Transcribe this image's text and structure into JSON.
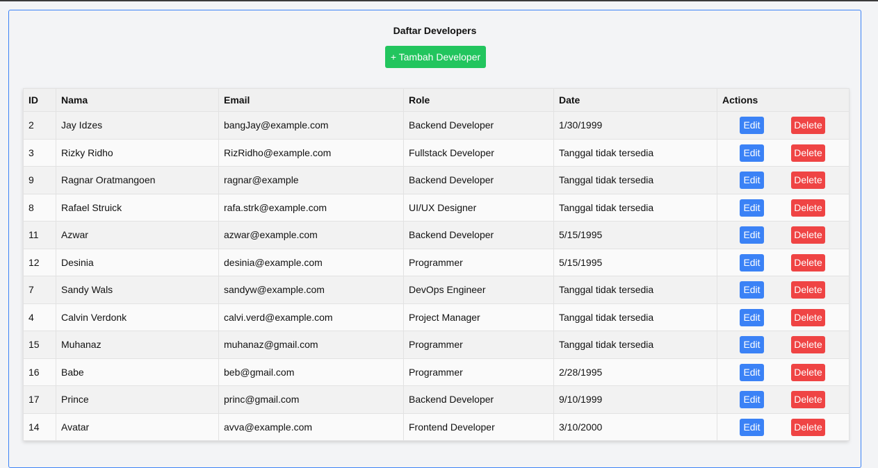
{
  "page": {
    "title": "Daftar Developers",
    "add_button_label": "+ Tambah Developer"
  },
  "colors": {
    "add_button": "#22c55e",
    "edit_button": "#3b82f6",
    "delete_button": "#ef4444",
    "card_border": "#3b82f6"
  },
  "table": {
    "headers": [
      "ID",
      "Nama",
      "Email",
      "Role",
      "Date",
      "Actions"
    ],
    "edit_label": "Edit",
    "delete_label": "Delete",
    "rows": [
      {
        "id": "2",
        "name": "Jay Idzes",
        "email": "bangJay@example.com",
        "role": "Backend Developer",
        "date": "1/30/1999"
      },
      {
        "id": "3",
        "name": "Rizky Ridho",
        "email": "RizRidho@example.com",
        "role": "Fullstack Developer",
        "date": "Tanggal tidak tersedia"
      },
      {
        "id": "9",
        "name": "Ragnar Oratmangoen",
        "email": "ragnar@example",
        "role": "Backend Developer",
        "date": "Tanggal tidak tersedia"
      },
      {
        "id": "8",
        "name": "Rafael Struick",
        "email": "rafa.strk@example.com",
        "role": "UI/UX Designer",
        "date": "Tanggal tidak tersedia"
      },
      {
        "id": "11",
        "name": "Azwar",
        "email": "azwar@example.com",
        "role": "Backend Developer",
        "date": "5/15/1995"
      },
      {
        "id": "12",
        "name": "Desinia",
        "email": "desinia@example.com",
        "role": "Programmer",
        "date": "5/15/1995"
      },
      {
        "id": "7",
        "name": "Sandy Wals",
        "email": "sandyw@example.com",
        "role": "DevOps Engineer",
        "date": "Tanggal tidak tersedia"
      },
      {
        "id": "4",
        "name": "Calvin Verdonk",
        "email": "calvi.verd@example.com",
        "role": "Project Manager",
        "date": "Tanggal tidak tersedia"
      },
      {
        "id": "15",
        "name": "Muhanaz",
        "email": "muhanaz@gmail.com",
        "role": "Programmer",
        "date": "Tanggal tidak tersedia"
      },
      {
        "id": "16",
        "name": "Babe",
        "email": "beb@gmail.com",
        "role": "Programmer",
        "date": "2/28/1995"
      },
      {
        "id": "17",
        "name": "Prince",
        "email": "princ@gmail.com",
        "role": "Backend Developer",
        "date": "9/10/1999"
      },
      {
        "id": "14",
        "name": "Avatar",
        "email": "avva@example.com",
        "role": "Frontend Developer",
        "date": "3/10/2000"
      }
    ]
  }
}
